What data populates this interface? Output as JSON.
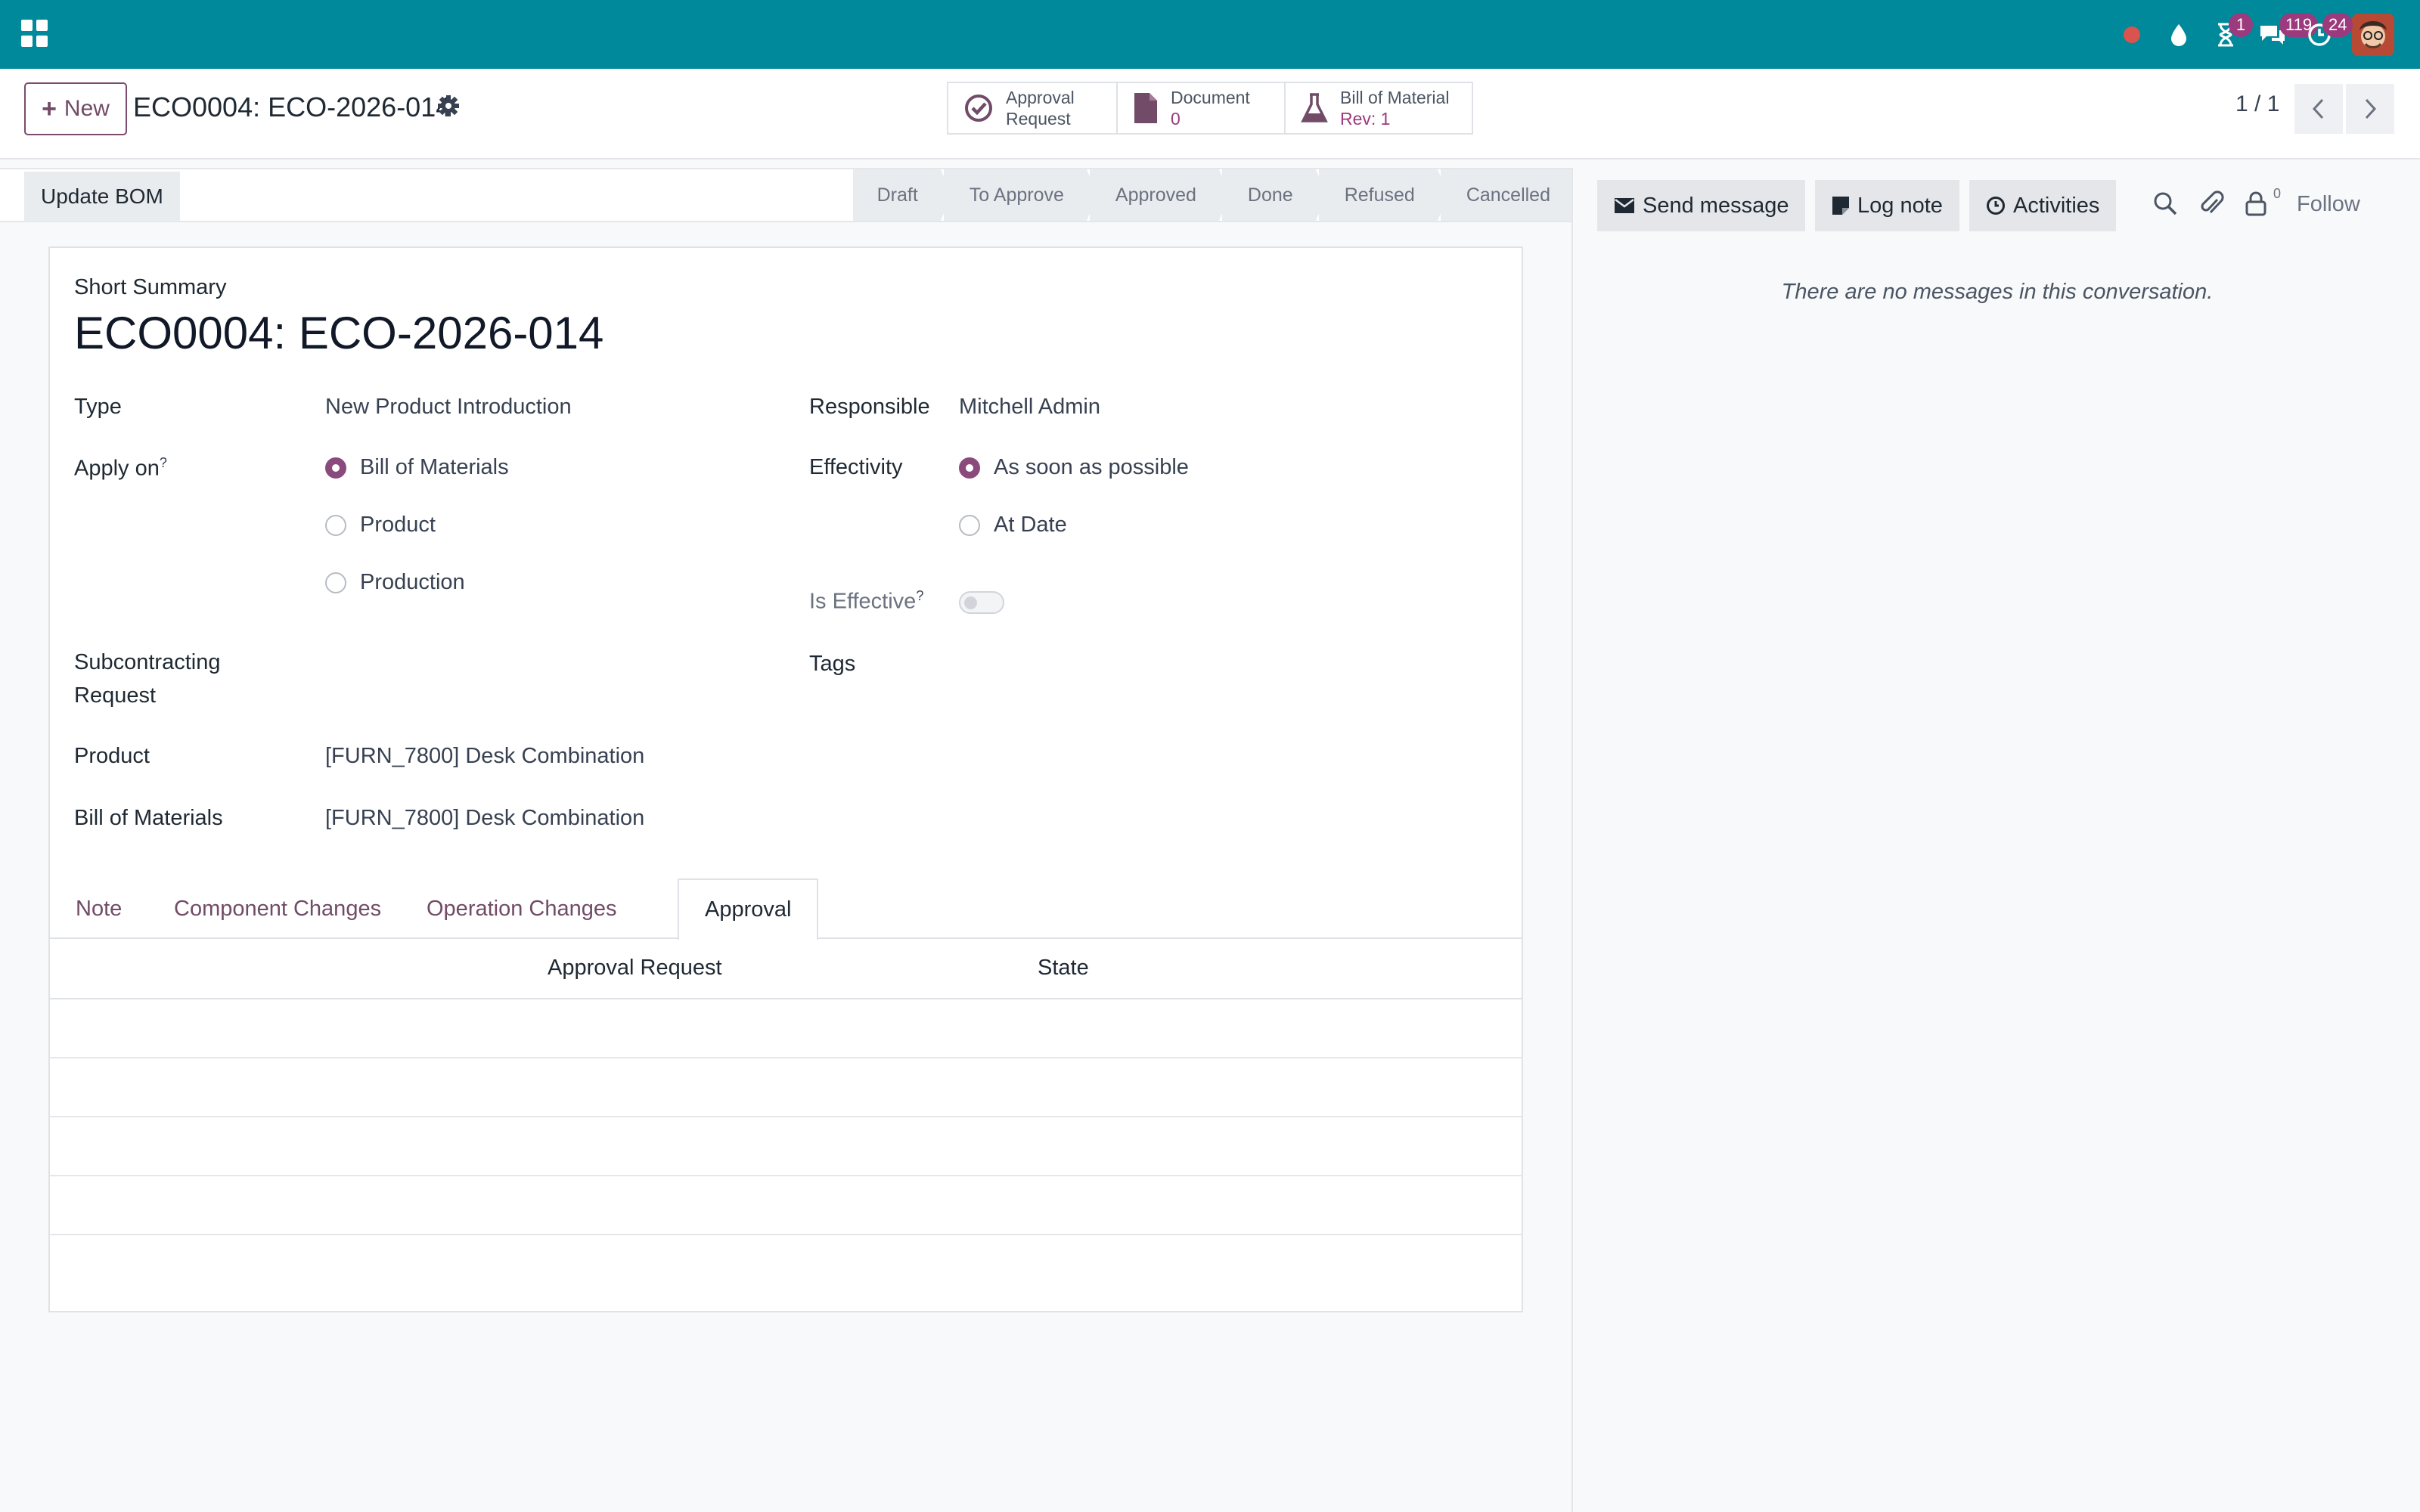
{
  "navbar": {
    "activity_badge": "1",
    "messages_badge": "119",
    "notifications_badge": "24",
    "accent": "#00899a",
    "badge_color": "#9b3a7c"
  },
  "control_panel": {
    "new_label": "New",
    "record_title": "ECO0004: ECO-2026-014",
    "pager": "1 / 1",
    "smart_buttons": [
      {
        "label": "Approval",
        "label2": "Request",
        "icon": "check-circle-icon"
      },
      {
        "label": "Document",
        "value": "0",
        "icon": "document-icon"
      },
      {
        "label": "Bill of Material",
        "value": "Rev: 1",
        "icon": "flask-icon"
      }
    ]
  },
  "statusbar": {
    "update_bom_label": "Update BOM",
    "stages": [
      "Draft",
      "To Approve",
      "Approved",
      "Done",
      "Refused",
      "Cancelled"
    ]
  },
  "form": {
    "short_summary_label": "Short Summary",
    "short_summary_value": "ECO0004: ECO-2026-014",
    "type_label": "Type",
    "type_value": "New Product Introduction",
    "apply_on_label": "Apply on",
    "apply_on_options": [
      "Bill of Materials",
      "Product",
      "Production"
    ],
    "apply_on_selected": "Bill of Materials",
    "subcontracting_label_1": "Subcontracting",
    "subcontracting_label_2": "Request",
    "product_label": "Product",
    "product_value": "[FURN_7800] Desk Combination",
    "bom_label": "Bill of Materials",
    "bom_value": "[FURN_7800] Desk Combination",
    "responsible_label": "Responsible",
    "responsible_value": "Mitchell Admin",
    "effectivity_label": "Effectivity",
    "effectivity_options": [
      "As soon as possible",
      "At Date"
    ],
    "effectivity_selected": "As soon as possible",
    "is_effective_label": "Is Effective",
    "is_effective_value": false,
    "tags_label": "Tags",
    "help_mark": "?"
  },
  "notebook": {
    "tabs": [
      "Note",
      "Component Changes",
      "Operation Changes",
      "Approval"
    ],
    "active_tab": "Approval",
    "columns": [
      "Approval Request",
      "State"
    ]
  },
  "chatter": {
    "send_message_label": "Send message",
    "log_note_label": "Log note",
    "activities_label": "Activities",
    "followers_count": "0",
    "follow_label": "Follow",
    "empty_text": "There are no messages in this conversation."
  }
}
